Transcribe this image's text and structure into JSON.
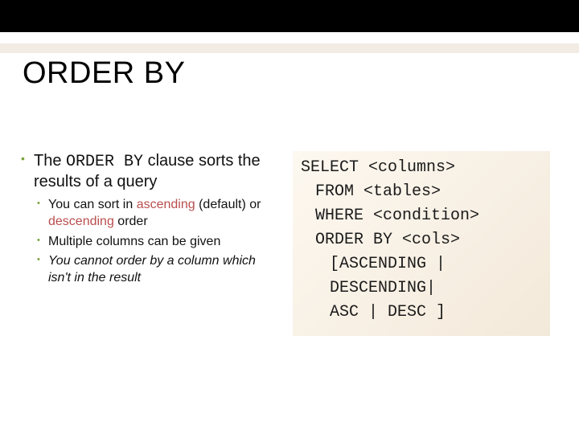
{
  "title": "ORDER BY",
  "left": {
    "bullet1_pre": "The ",
    "bullet1_code": "ORDER BY",
    "bullet1_post": " clause sorts the results of a query",
    "sub1_pre": "You can sort in ",
    "sub1_asc": "ascending",
    "sub1_mid": " (default) or ",
    "sub1_desc": "descending",
    "sub1_post": " order",
    "sub2": "Multiple columns can be given",
    "sub3_em": "You cannot order by a column which isn't in the result"
  },
  "code": {
    "l1": "SELECT <columns>",
    "l2": "FROM <tables>",
    "l3": "WHERE <condition>",
    "l4": "ORDER BY <cols>",
    "l5": "[ASCENDING |",
    "l6": "DESCENDING|",
    "l7": "ASC | DESC ]"
  }
}
